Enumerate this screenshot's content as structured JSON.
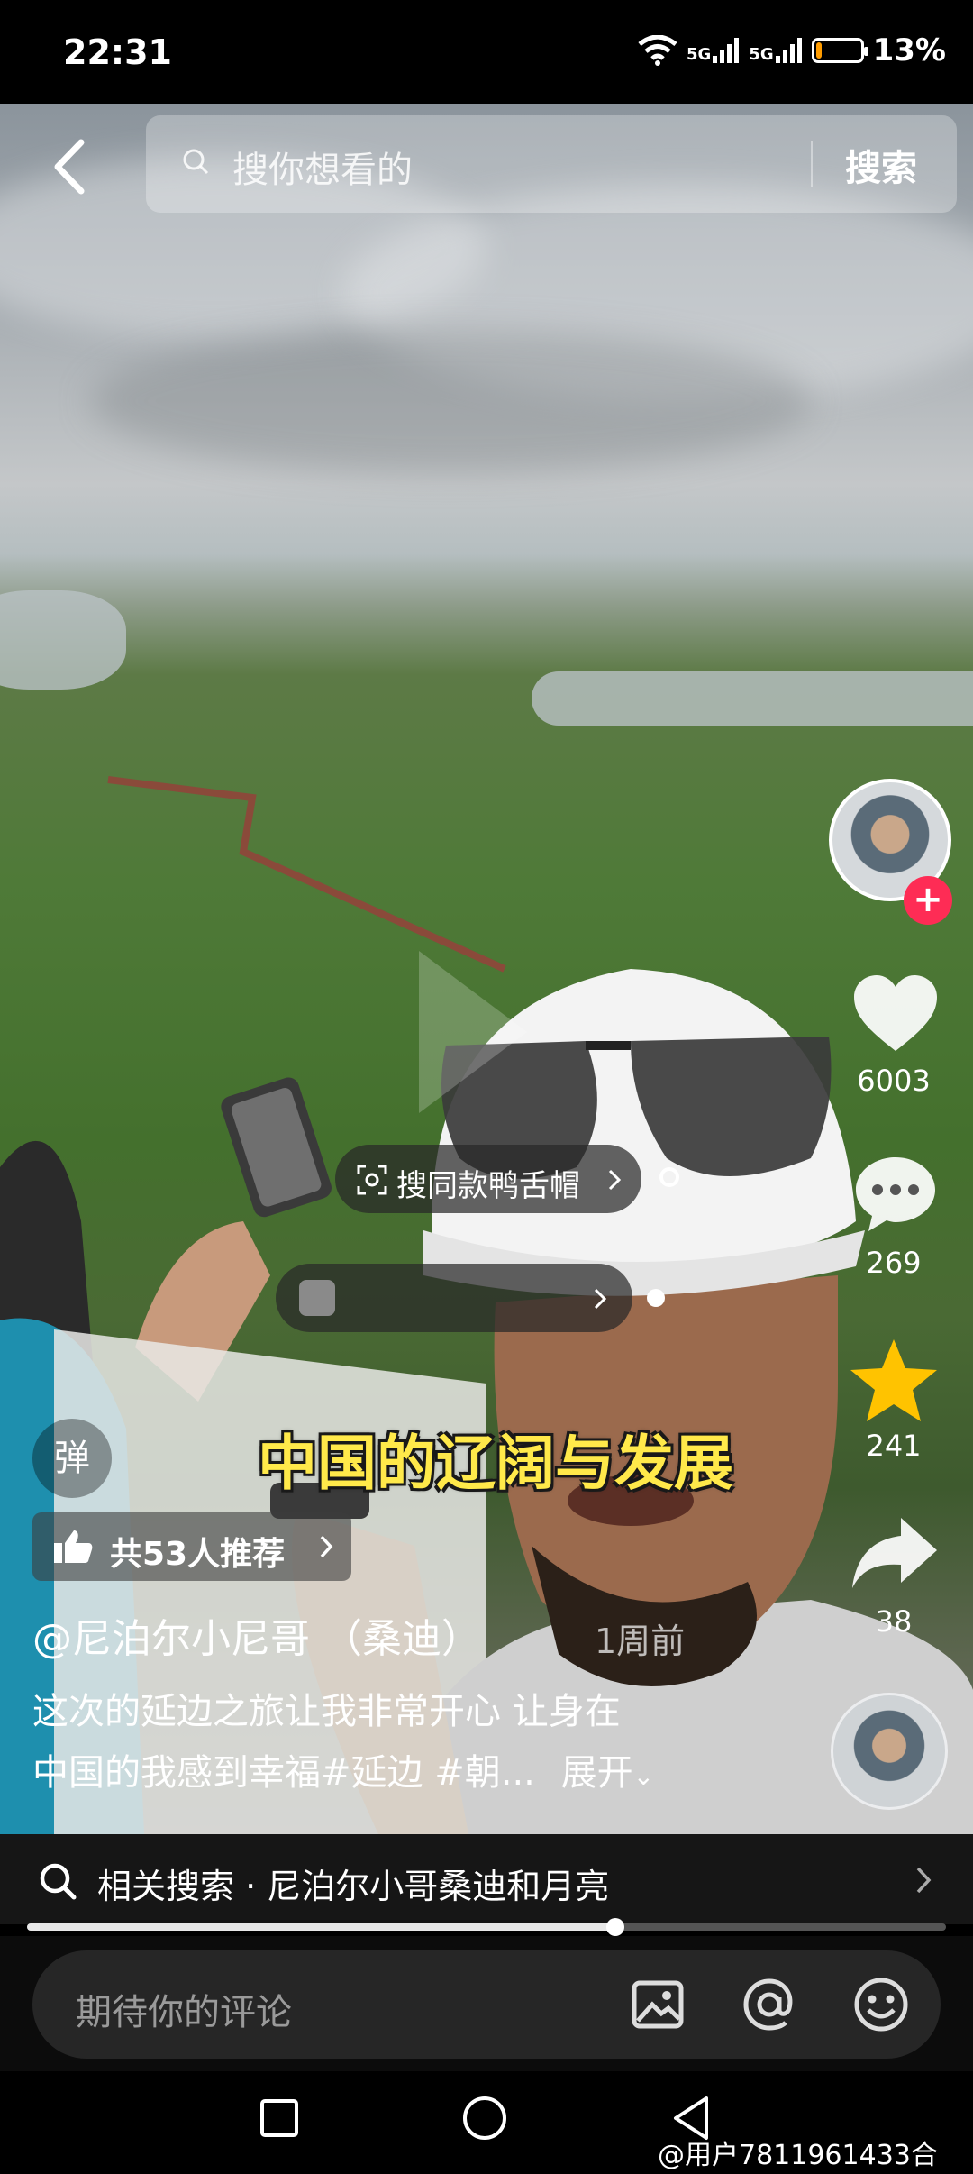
{
  "status_bar": {
    "time": "22:31",
    "network_1": "5G",
    "network_2": "5G",
    "battery_percent": "13%",
    "battery_level": 0.13,
    "battery_color": "#ff9c00"
  },
  "search": {
    "back_icon": "chevron-left-icon",
    "placeholder": "搜你想看的",
    "button_label": "搜索"
  },
  "sidebar": {
    "like_count": "6003",
    "comment_count": "269",
    "favorite_count": "241",
    "share_count": "38",
    "follow_color": "#fe2c55",
    "favorite_color": "#ffc300"
  },
  "overlay": {
    "product_chip_label": "搜同款鸭舌帽",
    "caption": "中国的辽阔与发展",
    "danmu_label": "弹",
    "recommend_label": "共53人推荐"
  },
  "post": {
    "author": "@尼泊尔小尼哥 （桑迪）",
    "time_ago": "1周前",
    "description_line1": "这次的延边之旅让我非常开心 让身在",
    "description_line2": "中国的我感到幸福#延边 #朝...",
    "expand_label": "展开"
  },
  "related_search": {
    "label": "相关搜索 · 尼泊尔小哥桑迪和月亮"
  },
  "playback": {
    "progress": 0.64
  },
  "comment_bar": {
    "placeholder": "期待你的评论"
  },
  "watermark": "@用户7811961433合"
}
